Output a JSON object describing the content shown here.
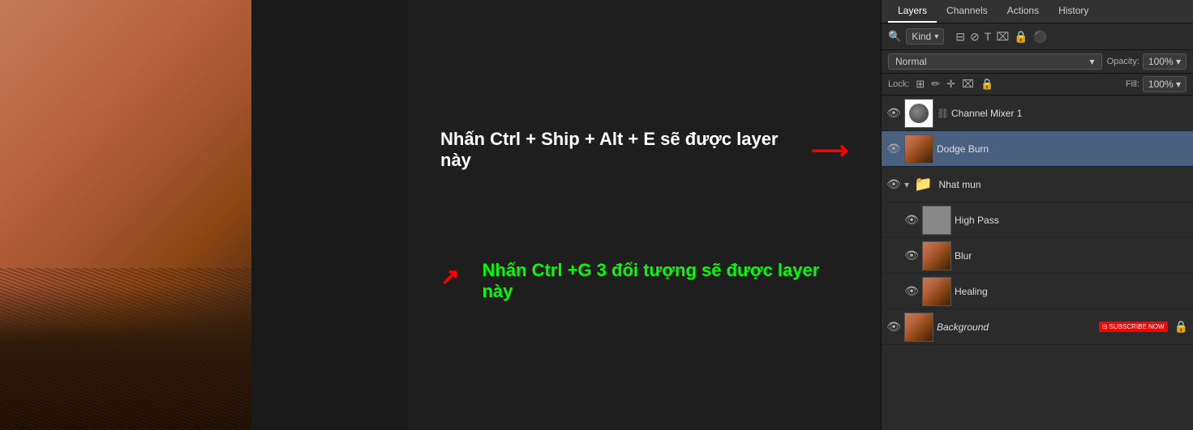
{
  "panel": {
    "tabs": [
      "Layers",
      "Channels",
      "Actions",
      "History"
    ],
    "activeTab": "Layers",
    "search": {
      "placeholder": "Kind",
      "icons": [
        "⊟",
        "⊘",
        "T",
        "⌧",
        "🔒",
        "⚫"
      ]
    },
    "blendMode": {
      "value": "Normal",
      "opacityLabel": "Opacity:",
      "opacityValue": "100%"
    },
    "lock": {
      "label": "Lock:",
      "icons": [
        "⊞",
        "✏",
        "⊕",
        "⌧",
        "🔒"
      ],
      "fillLabel": "Fill:",
      "fillValue": "100%"
    },
    "layers": [
      {
        "id": "channel-mixer-1",
        "name": "Channel Mixer 1",
        "visible": true,
        "thumbType": "adjustment",
        "hasChain": true,
        "selected": false
      },
      {
        "id": "dodge-burn",
        "name": "Dodge Burn",
        "visible": true,
        "thumbType": "portrait",
        "hasChain": false,
        "selected": true
      },
      {
        "id": "nhat-mun",
        "name": "Nhat mun",
        "visible": true,
        "thumbType": "folder",
        "isGroup": true,
        "children": [
          {
            "id": "high-pass",
            "name": "High Pass",
            "visible": true,
            "thumbType": "gray",
            "hasChain": false,
            "selected": false
          },
          {
            "id": "blur",
            "name": "Blur",
            "visible": true,
            "thumbType": "portrait-small",
            "hasChain": false,
            "selected": false
          },
          {
            "id": "healing",
            "name": "Healing",
            "visible": true,
            "thumbType": "portrait-small",
            "hasChain": false,
            "selected": false
          }
        ]
      },
      {
        "id": "background",
        "name": "Background",
        "visible": true,
        "thumbType": "portrait",
        "hasChain": false,
        "selected": false,
        "isItalic": true,
        "hasSubscribeBadge": true,
        "badgeText": "⊟ SUBSCRIBE NOW"
      }
    ]
  },
  "annotations": {
    "text1": "Nhấn Ctrl + Ship + Alt + E sẽ được layer này",
    "text2": "Nhấn Ctrl +G 3 đối tượng sẽ được layer này"
  }
}
